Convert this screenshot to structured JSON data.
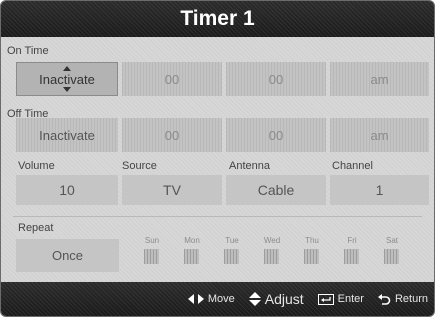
{
  "title": "Timer 1",
  "on_time": {
    "label": "On Time",
    "activation": "Inactivate",
    "hour": "00",
    "minute": "00",
    "ampm": "am"
  },
  "off_time": {
    "label": "Off Time",
    "activation": "Inactivate",
    "hour": "00",
    "minute": "00",
    "ampm": "am"
  },
  "volume": {
    "label": "Volume",
    "value": "10"
  },
  "source": {
    "label": "Source",
    "value": "TV"
  },
  "antenna": {
    "label": "Antenna",
    "value": "Cable"
  },
  "channel": {
    "label": "Channel",
    "value": "1"
  },
  "repeat": {
    "label": "Repeat",
    "value": "Once"
  },
  "days": [
    "Sun",
    "Mon",
    "Tue",
    "Wed",
    "Thu",
    "Fri",
    "Sat"
  ],
  "hints": {
    "move": "Move",
    "adjust": "Adjust",
    "enter": "Enter",
    "return": "Return"
  },
  "colors": {
    "bar": "#1e1e1e",
    "panel": "#d7d7d7",
    "selected": "#b3b3b3"
  },
  "icons": [
    "left-right-arrows-icon",
    "up-down-arrows-icon",
    "enter-icon",
    "return-icon"
  ]
}
